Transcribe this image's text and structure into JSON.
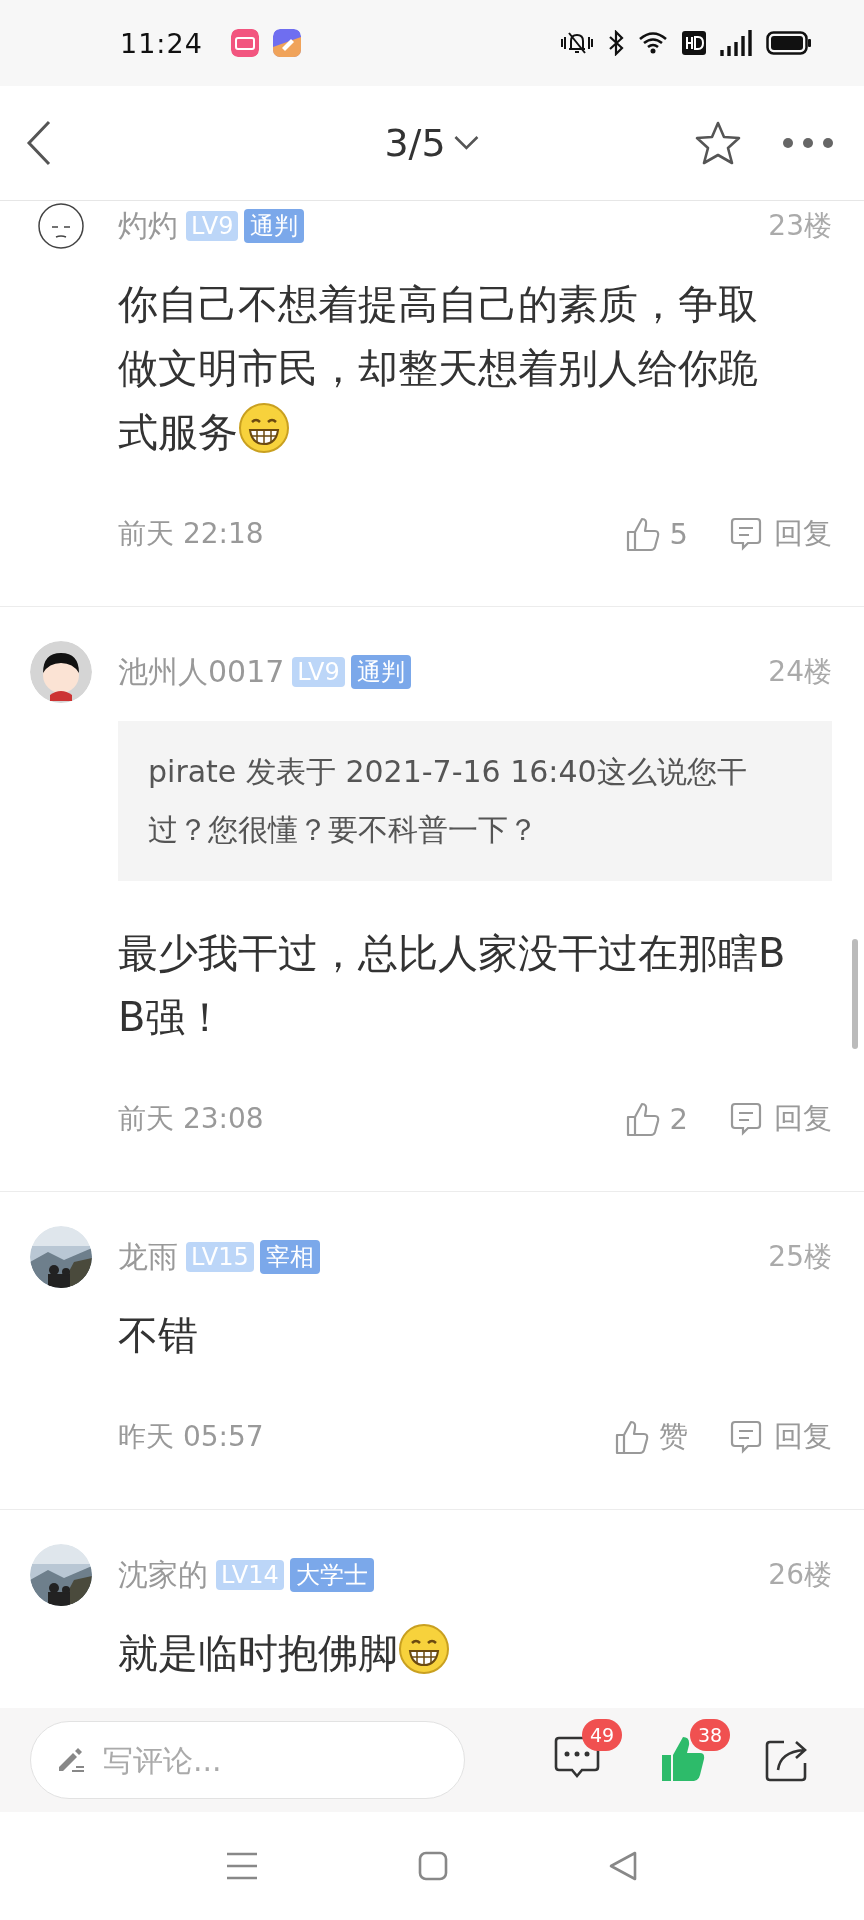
{
  "status_bar": {
    "time": "11:24"
  },
  "nav": {
    "title": "3/5"
  },
  "comments": [
    {
      "avatar": {
        "kind": "sketch"
      },
      "name": "灼灼",
      "level": "LV9",
      "title": "通判",
      "floor": "23楼",
      "text": "你自己不想着提高自己的素质，争取做文明市民，却整天想着别人给你跪式服务",
      "emoji": true,
      "time": "前天 22:18",
      "likes": "5",
      "reply": "回复"
    },
    {
      "avatar": {
        "kind": "cartoon"
      },
      "name": "池州人0017",
      "level": "LV9",
      "title": "通判",
      "floor": "24楼",
      "quote": "pirate 发表于 2021-7-16 16:40这么说您干过？您很懂？要不科普一下？",
      "text": "最少我干过，总比人家没干过在那瞎BB强！",
      "emoji": false,
      "time": "前天 23:08",
      "likes": "2",
      "reply": "回复"
    },
    {
      "name": "龙雨",
      "level": "LV15",
      "title": "宰相",
      "floor": "25楼",
      "text": "不错",
      "emoji": false,
      "time": "昨天 05:57",
      "likes": "赞",
      "reply": "回复"
    },
    {
      "name": "沈家的",
      "level": "LV14",
      "title": "大学士",
      "floor": "26楼",
      "text": "就是临时抱佛脚",
      "emoji": true
    }
  ],
  "bottom_bar": {
    "placeholder": "写评论...",
    "comment_count": "49",
    "like_count": "38"
  }
}
